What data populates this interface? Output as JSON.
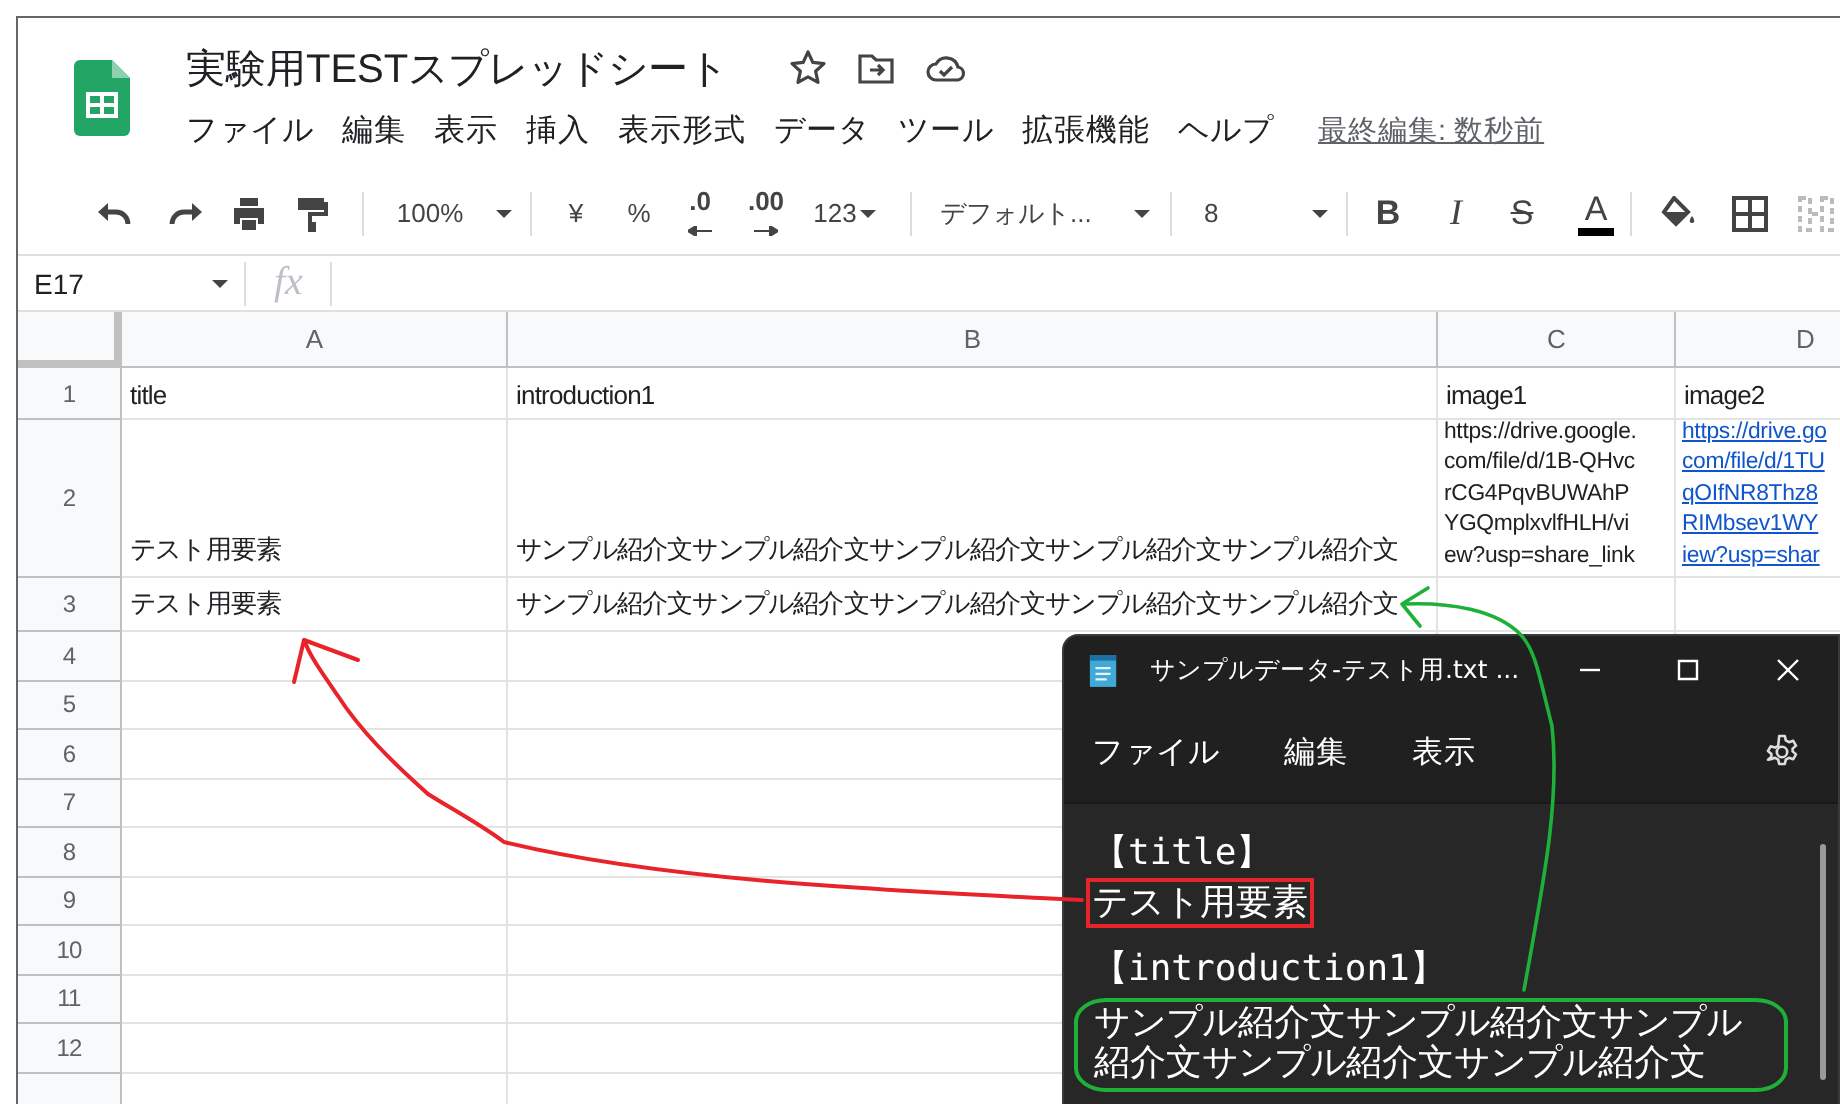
{
  "spreadsheet": {
    "title": "実験用TESTスプレッドシート",
    "menu": [
      "ファイル",
      "編集",
      "表示",
      "挿入",
      "表示形式",
      "データ",
      "ツール",
      "拡張機能",
      "ヘルプ"
    ],
    "last_edit": "最終編集: 数秒前",
    "toolbar": {
      "zoom": "100%",
      "currency": "¥",
      "percent": "%",
      "decrease_decimal": ".0",
      "increase_decimal": ".00",
      "number_format": "123",
      "font": "デフォルト...",
      "font_size": "8",
      "bold": "B",
      "italic": "I",
      "strikethrough": "S",
      "text_color": "A"
    },
    "name_box": "E17",
    "formula_label": "fx",
    "columns": [
      "A",
      "B",
      "C",
      "D"
    ],
    "rows": [
      {
        "number": "1",
        "cells": [
          {
            "text": "title",
            "kind": "text"
          },
          {
            "text": "introduction1",
            "kind": "text"
          },
          {
            "text": "image1",
            "kind": "text"
          },
          {
            "text": "image2",
            "kind": "text"
          }
        ]
      },
      {
        "number": "2",
        "cells": [
          {
            "text": "テスト用要素",
            "kind": "text"
          },
          {
            "text": "サンプル紹介文サンプル紹介文サンプル紹介文サンプル紹介文サンプル紹介文",
            "kind": "text"
          },
          {
            "text": "https://drive.google.\ncom/file/d/1B-QHvc\nrCG4PqvBUWAhP\nYGQmplxvlfHLH/vi\new?usp=share_link",
            "kind": "wrapped"
          },
          {
            "text": "https://drive.go\ncom/file/d/1TU\nqOIfNR8Thz8\nRIMbsev1WY\niew?usp=shar",
            "kind": "link"
          }
        ]
      },
      {
        "number": "3",
        "cells": [
          {
            "text": "テスト用要素",
            "kind": "text"
          },
          {
            "text": "サンプル紹介文サンプル紹介文サンプル紹介文サンプル紹介文サンプル紹介文",
            "kind": "text"
          }
        ]
      },
      {
        "number": "4"
      },
      {
        "number": "5"
      },
      {
        "number": "6"
      },
      {
        "number": "7"
      },
      {
        "number": "8"
      },
      {
        "number": "9"
      },
      {
        "number": "10"
      },
      {
        "number": "11"
      },
      {
        "number": "12"
      }
    ]
  },
  "notepad": {
    "title": "サンプルデータ-テスト用.txt ...",
    "menu": [
      "ファイル",
      "編集",
      "表示"
    ],
    "sections": [
      {
        "heading": "【title】",
        "body": "テスト用要素"
      },
      {
        "heading": "【introduction1】",
        "body": "サンプル紹介文サンプル紹介文サンプル紹介文サンプル紹介文サンプル紹介文"
      }
    ]
  }
}
